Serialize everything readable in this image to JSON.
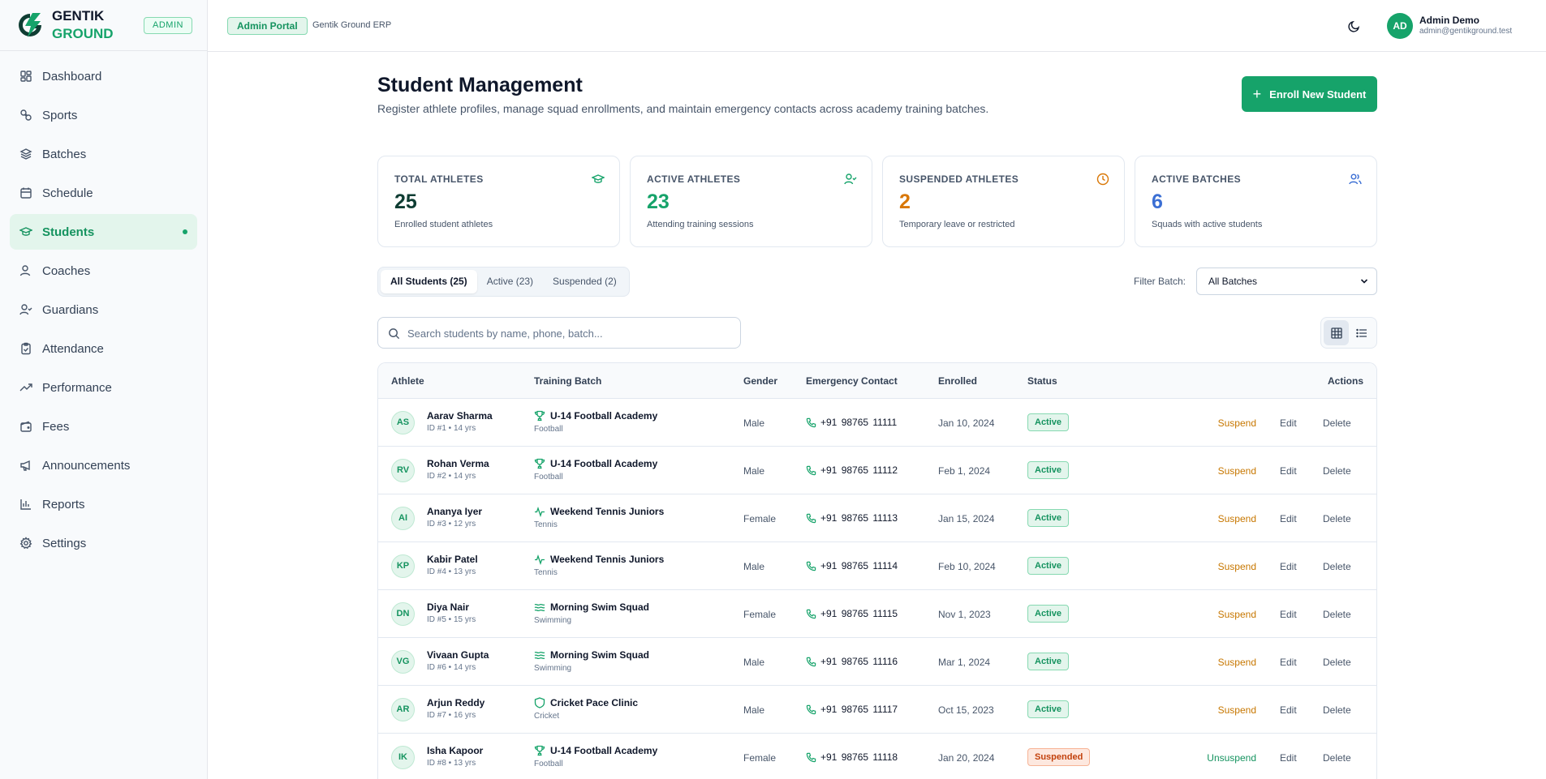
{
  "brand": {
    "line1": "GENTIK",
    "line2": "GROUND",
    "role_badge": "ADMIN"
  },
  "sidebar": {
    "items": [
      {
        "label": "Dashboard",
        "icon": "dashboard-icon"
      },
      {
        "label": "Sports",
        "icon": "sports-icon"
      },
      {
        "label": "Batches",
        "icon": "layers-icon"
      },
      {
        "label": "Schedule",
        "icon": "calendar-icon"
      },
      {
        "label": "Students",
        "icon": "graduation-cap-icon",
        "active": true
      },
      {
        "label": "Coaches",
        "icon": "user-icon"
      },
      {
        "label": "Guardians",
        "icon": "user-check-icon"
      },
      {
        "label": "Attendance",
        "icon": "clipboard-check-icon"
      },
      {
        "label": "Performance",
        "icon": "trending-up-icon"
      },
      {
        "label": "Fees",
        "icon": "wallet-icon"
      },
      {
        "label": "Announcements",
        "icon": "megaphone-icon"
      },
      {
        "label": "Reports",
        "icon": "bar-chart-icon"
      },
      {
        "label": "Settings",
        "icon": "gear-icon"
      }
    ]
  },
  "topbar": {
    "portal_badge": "Admin Portal",
    "portal_sub": "Gentik Ground ERP",
    "user": {
      "initials": "AD",
      "name": "Admin Demo",
      "email": "admin@gentikground.test"
    }
  },
  "page": {
    "title": "Student Management",
    "subtitle": "Register athlete profiles, manage squad enrollments, and maintain emergency contacts across academy training batches.",
    "enroll_button": "Enroll New Student"
  },
  "stats": [
    {
      "label": "TOTAL ATHLETES",
      "value": "25",
      "desc": "Enrolled student athletes",
      "color": "#0f3d33",
      "icon_color": "#16a36a"
    },
    {
      "label": "ACTIVE ATHLETES",
      "value": "23",
      "desc": "Attending training sessions",
      "color": "#16a36a",
      "icon_color": "#16a36a"
    },
    {
      "label": "SUSPENDED ATHLETES",
      "value": "2",
      "desc": "Temporary leave or restricted",
      "color": "#d97706",
      "icon_color": "#d97706"
    },
    {
      "label": "ACTIVE BATCHES",
      "value": "6",
      "desc": "Squads with active students",
      "color": "#3b6fd4",
      "icon_color": "#3b6fd4"
    }
  ],
  "tabs": [
    {
      "label": "All Students (25)",
      "active": true
    },
    {
      "label": "Active (23)",
      "active": false
    },
    {
      "label": "Suspended (2)",
      "active": false
    }
  ],
  "filter": {
    "label": "Filter Batch:",
    "selected": "All Batches"
  },
  "search": {
    "placeholder": "Search students by name, phone, batch..."
  },
  "table": {
    "headers": {
      "athlete": "Athlete",
      "batch": "Training Batch",
      "gender": "Gender",
      "contact": "Emergency Contact",
      "enrolled": "Enrolled",
      "status": "Status",
      "actions": "Actions"
    },
    "edit_label": "Edit",
    "delete_label": "Delete",
    "rows": [
      {
        "initials": "AS",
        "name": "Aarav Sharma",
        "meta": "ID #1  • 14 yrs",
        "batch": "U-14 Football Academy",
        "batch_icon": "trophy-icon",
        "sport": "Football",
        "gender": "Male",
        "phone": "+91 98765 11111",
        "enrolled": "Jan 10, 2024",
        "status": "Active",
        "action": "Suspend"
      },
      {
        "initials": "RV",
        "name": "Rohan Verma",
        "meta": "ID #2  • 14 yrs",
        "batch": "U-14 Football Academy",
        "batch_icon": "trophy-icon",
        "sport": "Football",
        "gender": "Male",
        "phone": "+91 98765 11112",
        "enrolled": "Feb 1, 2024",
        "status": "Active",
        "action": "Suspend"
      },
      {
        "initials": "AI",
        "name": "Ananya Iyer",
        "meta": "ID #3  • 12 yrs",
        "batch": "Weekend Tennis Juniors",
        "batch_icon": "activity-icon",
        "sport": "Tennis",
        "gender": "Female",
        "phone": "+91 98765 11113",
        "enrolled": "Jan 15, 2024",
        "status": "Active",
        "action": "Suspend"
      },
      {
        "initials": "KP",
        "name": "Kabir Patel",
        "meta": "ID #4  • 13 yrs",
        "batch": "Weekend Tennis Juniors",
        "batch_icon": "activity-icon",
        "sport": "Tennis",
        "gender": "Male",
        "phone": "+91 98765 11114",
        "enrolled": "Feb 10, 2024",
        "status": "Active",
        "action": "Suspend"
      },
      {
        "initials": "DN",
        "name": "Diya Nair",
        "meta": "ID #5  • 15 yrs",
        "batch": "Morning Swim Squad",
        "batch_icon": "waves-icon",
        "sport": "Swimming",
        "gender": "Female",
        "phone": "+91 98765 11115",
        "enrolled": "Nov 1, 2023",
        "status": "Active",
        "action": "Suspend"
      },
      {
        "initials": "VG",
        "name": "Vivaan Gupta",
        "meta": "ID #6  • 14 yrs",
        "batch": "Morning Swim Squad",
        "batch_icon": "waves-icon",
        "sport": "Swimming",
        "gender": "Male",
        "phone": "+91 98765 11116",
        "enrolled": "Mar 1, 2024",
        "status": "Active",
        "action": "Suspend"
      },
      {
        "initials": "AR",
        "name": "Arjun Reddy",
        "meta": "ID #7  • 16 yrs",
        "batch": "Cricket Pace Clinic",
        "batch_icon": "shield-icon",
        "sport": "Cricket",
        "gender": "Male",
        "phone": "+91 98765 11117",
        "enrolled": "Oct 15, 2023",
        "status": "Active",
        "action": "Suspend"
      },
      {
        "initials": "IK",
        "name": "Isha Kapoor",
        "meta": "ID #8  • 13 yrs",
        "batch": "U-14 Football Academy",
        "batch_icon": "trophy-icon",
        "sport": "Football",
        "gender": "Female",
        "phone": "+91 98765 11118",
        "enrolled": "Jan 20, 2024",
        "status": "Suspended",
        "action": "Unsuspend"
      }
    ]
  }
}
